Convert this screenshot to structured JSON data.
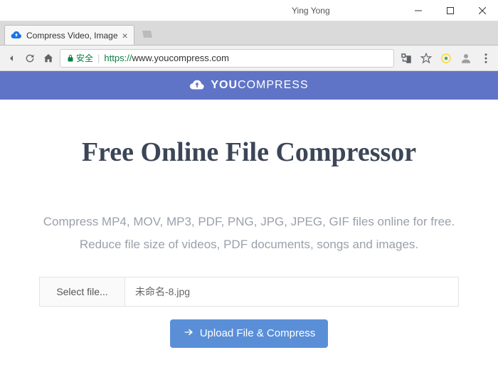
{
  "window": {
    "user_label": "Ying Yong"
  },
  "tab": {
    "title": "Compress Video, Image",
    "favicon_color": "#1a73e8"
  },
  "addressbar": {
    "secure_label": "安全",
    "protocol": "https://",
    "url": "www.youcompress.com"
  },
  "brand": {
    "part1": "YOU",
    "part2": "COMPRESS"
  },
  "hero": {
    "title": "Free Online File Compressor"
  },
  "description": "Compress MP4, MOV, MP3, PDF, PNG, JPG, JPEG, GIF files online for free. Reduce file size of videos, PDF documents, songs and images.",
  "fileselect": {
    "button_label": "Select file...",
    "filename": "未命名-8.jpg"
  },
  "upload": {
    "button_label": "Upload File & Compress"
  }
}
